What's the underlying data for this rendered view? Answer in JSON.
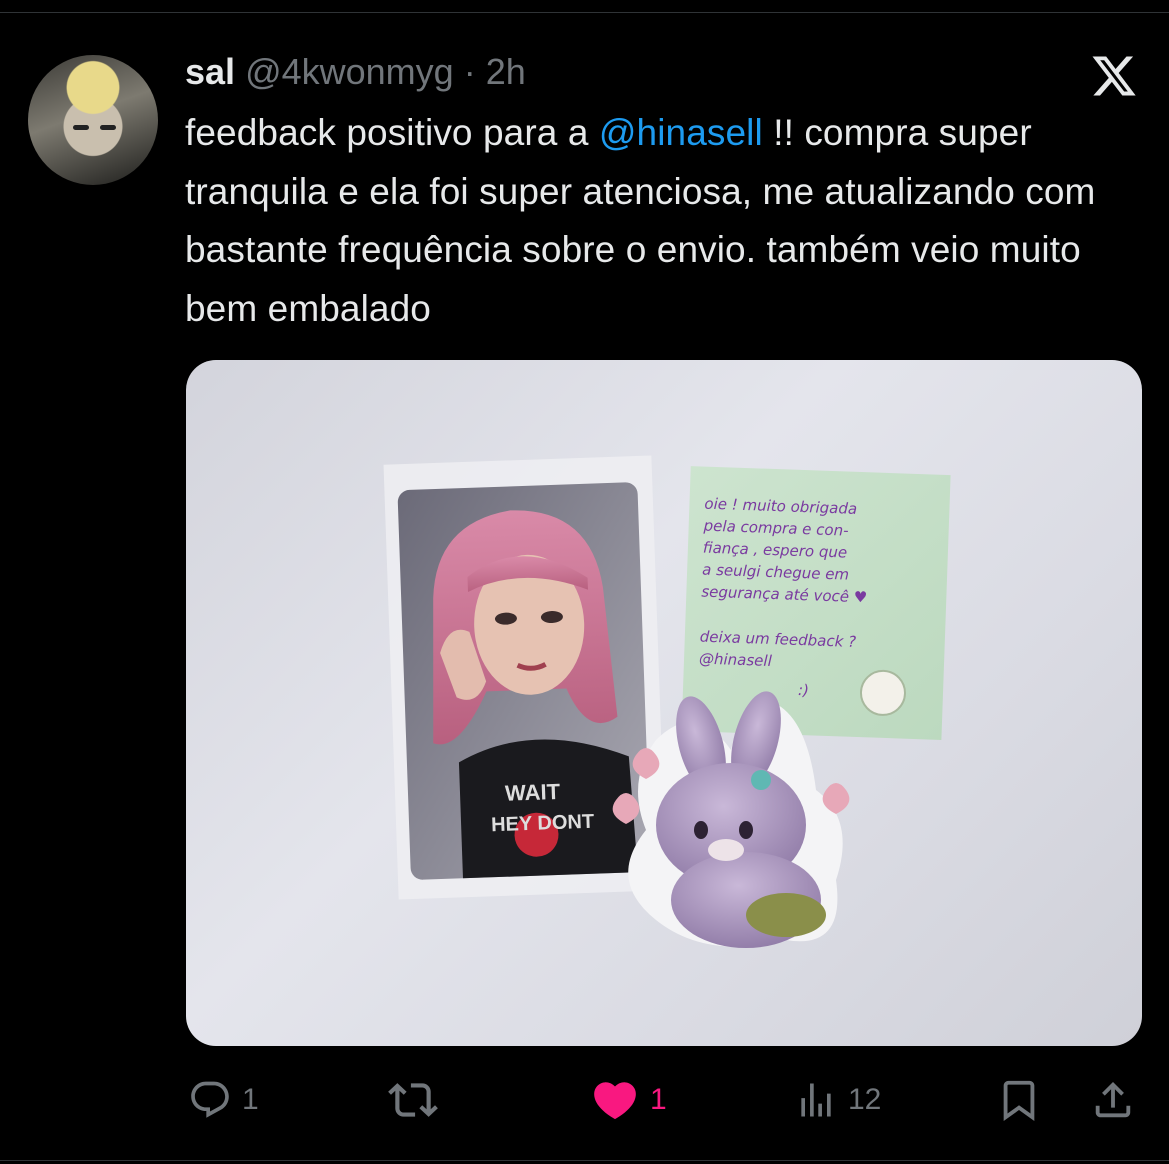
{
  "tweet": {
    "author_name": "sal",
    "handle": "@4kwonmyg",
    "separator": "·",
    "time": "2h",
    "text_before": "feedback positivo para a ",
    "mention": "@hinasell",
    "text_after": " !! compra super tranquila e ela foi super atenciosa, me atualizando com bastante frequência sobre o envio. também veio muito bem embalado"
  },
  "media": {
    "photocard_shirt_line1": "WAIT",
    "photocard_shirt_line2": "HEY DONT",
    "note_lines": [
      "oie ! muito obrigada",
      "pela compra e con-",
      "fiança , espero que",
      "a seulgi chegue em",
      "segurança até você ♥",
      "deixa um feedback ?",
      "@hinasell",
      ":)"
    ]
  },
  "actions": {
    "replies": "1",
    "retweets": "",
    "likes": "1",
    "views": "12"
  },
  "colors": {
    "background": "#000000",
    "text": "#e7e9ea",
    "muted": "#71767b",
    "link": "#1d9bf0",
    "like": "#f91880"
  },
  "icons": [
    "x-logo-icon",
    "reply-icon",
    "retweet-icon",
    "heart-icon",
    "views-icon",
    "bookmark-icon",
    "share-icon"
  ]
}
